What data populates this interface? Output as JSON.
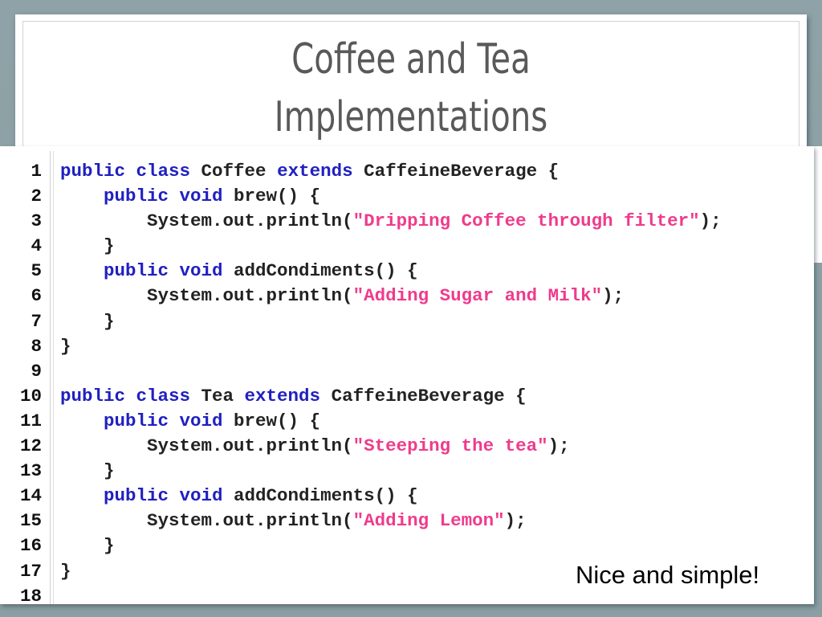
{
  "slide": {
    "title_lines": [
      "Coffee and Tea",
      "Implementations"
    ],
    "caption": "Nice and simple!",
    "colors": {
      "background": "#8ea1a6",
      "keyword": "#2020c0",
      "string": "#ef3b8c",
      "plain": "#222222",
      "title_text": "#595959"
    }
  },
  "code": {
    "language": "java",
    "lines": [
      {
        "n": "1",
        "tokens": [
          {
            "t": "kw",
            "v": "public class"
          },
          {
            "t": "pl",
            "v": " Coffee "
          },
          {
            "t": "kw",
            "v": "extends"
          },
          {
            "t": "pl",
            "v": " CaffeineBeverage {"
          }
        ]
      },
      {
        "n": "2",
        "tokens": [
          {
            "t": "pl",
            "v": "    "
          },
          {
            "t": "kw",
            "v": "public void"
          },
          {
            "t": "pl",
            "v": " brew() {"
          }
        ]
      },
      {
        "n": "3",
        "tokens": [
          {
            "t": "pl",
            "v": "        System.out.println("
          },
          {
            "t": "str",
            "v": "\"Dripping Coffee through filter\""
          },
          {
            "t": "pl",
            "v": ");"
          }
        ]
      },
      {
        "n": "4",
        "tokens": [
          {
            "t": "pl",
            "v": "    }"
          }
        ]
      },
      {
        "n": "5",
        "tokens": [
          {
            "t": "pl",
            "v": "    "
          },
          {
            "t": "kw",
            "v": "public void"
          },
          {
            "t": "pl",
            "v": " addCondiments() {"
          }
        ]
      },
      {
        "n": "6",
        "tokens": [
          {
            "t": "pl",
            "v": "        System.out.println("
          },
          {
            "t": "str",
            "v": "\"Adding Sugar and Milk\""
          },
          {
            "t": "pl",
            "v": ");"
          }
        ]
      },
      {
        "n": "7",
        "tokens": [
          {
            "t": "pl",
            "v": "    }"
          }
        ]
      },
      {
        "n": "8",
        "tokens": [
          {
            "t": "pl",
            "v": "}"
          }
        ]
      },
      {
        "n": "9",
        "tokens": []
      },
      {
        "n": "10",
        "tokens": [
          {
            "t": "kw",
            "v": "public class"
          },
          {
            "t": "pl",
            "v": " Tea "
          },
          {
            "t": "kw",
            "v": "extends"
          },
          {
            "t": "pl",
            "v": " CaffeineBeverage {"
          }
        ]
      },
      {
        "n": "11",
        "tokens": [
          {
            "t": "pl",
            "v": "    "
          },
          {
            "t": "kw",
            "v": "public void"
          },
          {
            "t": "pl",
            "v": " brew() {"
          }
        ]
      },
      {
        "n": "12",
        "tokens": [
          {
            "t": "pl",
            "v": "        System.out.println("
          },
          {
            "t": "str",
            "v": "\"Steeping the tea\""
          },
          {
            "t": "pl",
            "v": ");"
          }
        ]
      },
      {
        "n": "13",
        "tokens": [
          {
            "t": "pl",
            "v": "    }"
          }
        ]
      },
      {
        "n": "14",
        "tokens": [
          {
            "t": "pl",
            "v": "    "
          },
          {
            "t": "kw",
            "v": "public void"
          },
          {
            "t": "pl",
            "v": " addCondiments() {"
          }
        ]
      },
      {
        "n": "15",
        "tokens": [
          {
            "t": "pl",
            "v": "        System.out.println("
          },
          {
            "t": "str",
            "v": "\"Adding Lemon\""
          },
          {
            "t": "pl",
            "v": ");"
          }
        ]
      },
      {
        "n": "16",
        "tokens": [
          {
            "t": "pl",
            "v": "    }"
          }
        ]
      },
      {
        "n": "17",
        "tokens": [
          {
            "t": "pl",
            "v": "}"
          }
        ]
      },
      {
        "n": "18",
        "tokens": []
      }
    ]
  }
}
